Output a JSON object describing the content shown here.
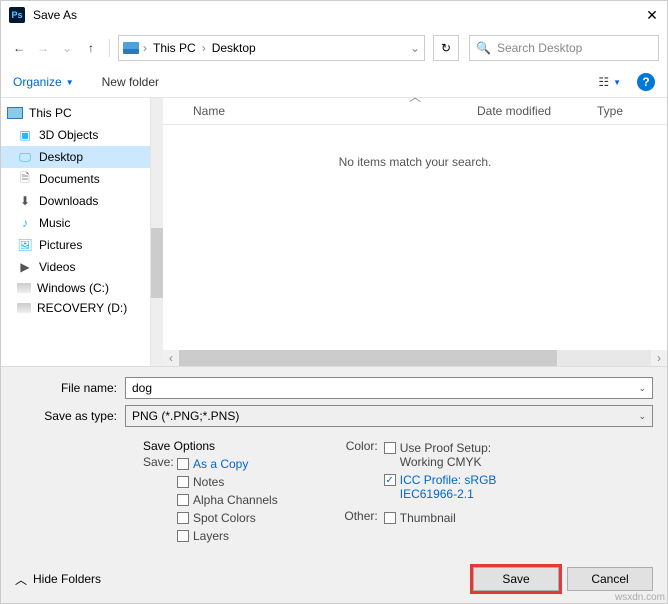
{
  "title": "Save As",
  "breadcrumb": {
    "root_icon": "drive",
    "part1": "This PC",
    "part2": "Desktop"
  },
  "search_placeholder": "Search Desktop",
  "toolbar": {
    "organize": "Organize",
    "new_folder": "New folder"
  },
  "file_header": {
    "name": "Name",
    "date": "Date modified",
    "type": "Type"
  },
  "empty_message": "No items match your search.",
  "tree": {
    "root": "This PC",
    "items": [
      {
        "label": "3D Objects",
        "icon": "3d"
      },
      {
        "label": "Desktop",
        "icon": "desktop",
        "selected": true
      },
      {
        "label": "Documents",
        "icon": "doc"
      },
      {
        "label": "Downloads",
        "icon": "dl"
      },
      {
        "label": "Music",
        "icon": "music"
      },
      {
        "label": "Pictures",
        "icon": "pic"
      },
      {
        "label": "Videos",
        "icon": "vid"
      },
      {
        "label": "Windows (C:)",
        "icon": "drive"
      },
      {
        "label": "RECOVERY (D:)",
        "icon": "drive"
      }
    ]
  },
  "file_name_label": "File name:",
  "file_name_value": "dog",
  "save_type_label": "Save as type:",
  "save_type_value": "PNG (*.PNG;*.PNS)",
  "save_options_header": "Save Options",
  "save_label": "Save:",
  "options_save": [
    {
      "label": "As a Copy",
      "checked": false,
      "link": true
    },
    {
      "label": "Notes",
      "checked": false
    },
    {
      "label": "Alpha Channels",
      "checked": false
    },
    {
      "label": "Spot Colors",
      "checked": false
    },
    {
      "label": "Layers",
      "checked": false
    }
  ],
  "color_label": "Color:",
  "color_options": {
    "proof": {
      "line1": "Use Proof Setup:",
      "line2": "Working CMYK",
      "checked": false
    },
    "icc": {
      "line1": "ICC Profile: sRGB",
      "line2": "IEC61966-2.1",
      "checked": true
    }
  },
  "other_label": "Other:",
  "other_option": {
    "label": "Thumbnail",
    "checked": false
  },
  "hide_folders": "Hide Folders",
  "buttons": {
    "save": "Save",
    "cancel": "Cancel"
  },
  "watermark": "wsxdn.com"
}
